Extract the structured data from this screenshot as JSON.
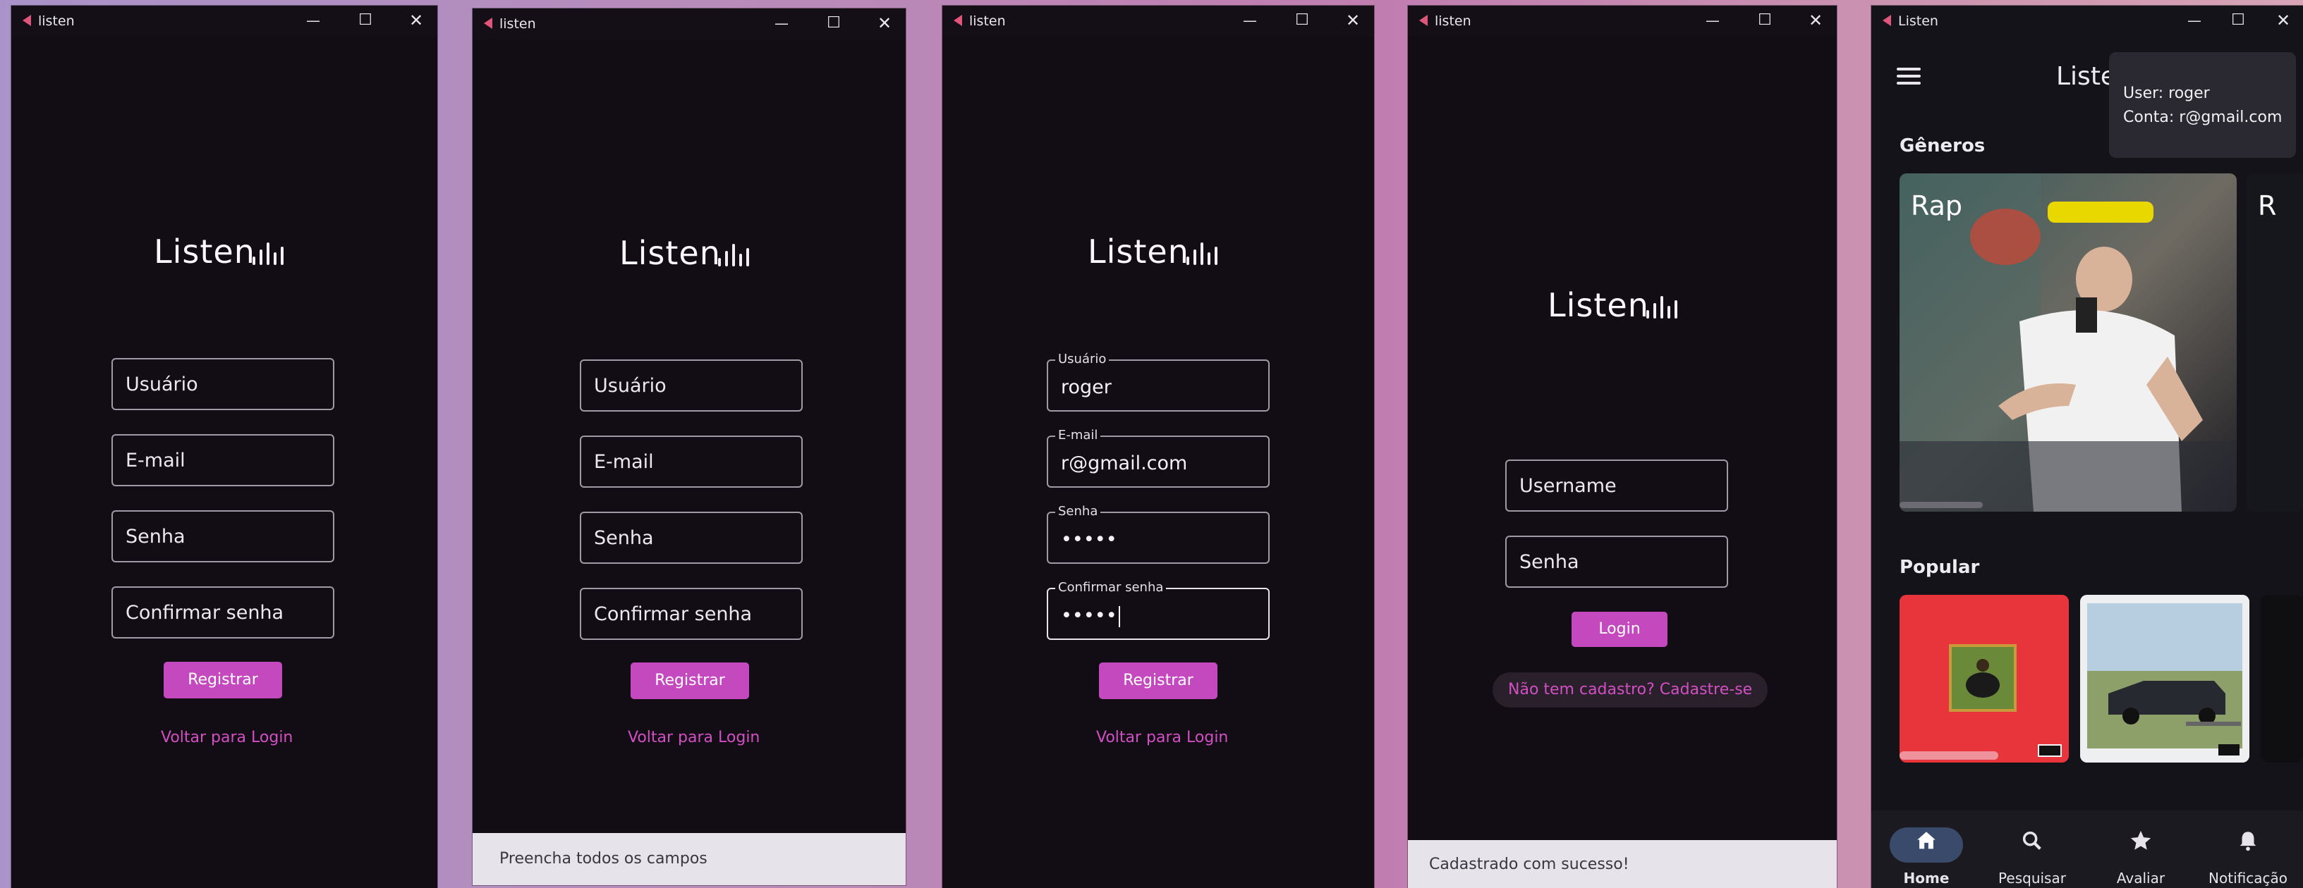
{
  "windows": [
    {
      "title": "listen",
      "logo": "Listen",
      "fields": [
        {
          "placeholder": "Usuário"
        },
        {
          "placeholder": "E-mail"
        },
        {
          "placeholder": "Senha"
        },
        {
          "placeholder": "Confirmar senha"
        }
      ],
      "primary_button": "Registrar",
      "link": "Voltar para Login"
    },
    {
      "title": "listen",
      "logo": "Listen",
      "fields": [
        {
          "placeholder": "Usuário"
        },
        {
          "placeholder": "E-mail"
        },
        {
          "placeholder": "Senha"
        },
        {
          "placeholder": "Confirmar senha"
        }
      ],
      "primary_button": "Registrar",
      "link": "Voltar para Login",
      "snackbar": "Preencha todos os campos"
    },
    {
      "title": "listen",
      "logo": "Listen",
      "fields": [
        {
          "label": "Usuário",
          "value": "roger"
        },
        {
          "label": "E-mail",
          "value": "r@gmail.com"
        },
        {
          "label": "Senha",
          "value": "•••••"
        },
        {
          "label": "Confirmar senha",
          "value": "•••••"
        }
      ],
      "primary_button": "Registrar",
      "link": "Voltar para Login"
    },
    {
      "title": "listen",
      "logo": "Listen",
      "fields": [
        {
          "placeholder": "Username"
        },
        {
          "placeholder": "Senha"
        }
      ],
      "primary_button": "Login",
      "link": "Não tem cadastro? Cadastre-se",
      "snackbar": "Cadastrado com sucesso!"
    },
    {
      "title": "Listen",
      "app_title": "Liste",
      "tooltip": {
        "user": "User: roger",
        "account": "Conta: r@gmail.com"
      },
      "genres_heading": "Gêneros",
      "genres": [
        "Rap",
        "R"
      ],
      "popular_heading": "Popular",
      "nav": [
        {
          "label": "Home",
          "icon": "home-icon",
          "active": true
        },
        {
          "label": "Pesquisar",
          "icon": "search-icon",
          "active": false
        },
        {
          "label": "Avaliar",
          "icon": "star-icon",
          "active": false
        },
        {
          "label": "Notificação",
          "icon": "bell-icon",
          "active": false
        }
      ]
    }
  ],
  "colors": {
    "background": "#120c14",
    "accent": "#c449be",
    "link": "#d24fc3",
    "snackbar": "#e6e4ea"
  }
}
